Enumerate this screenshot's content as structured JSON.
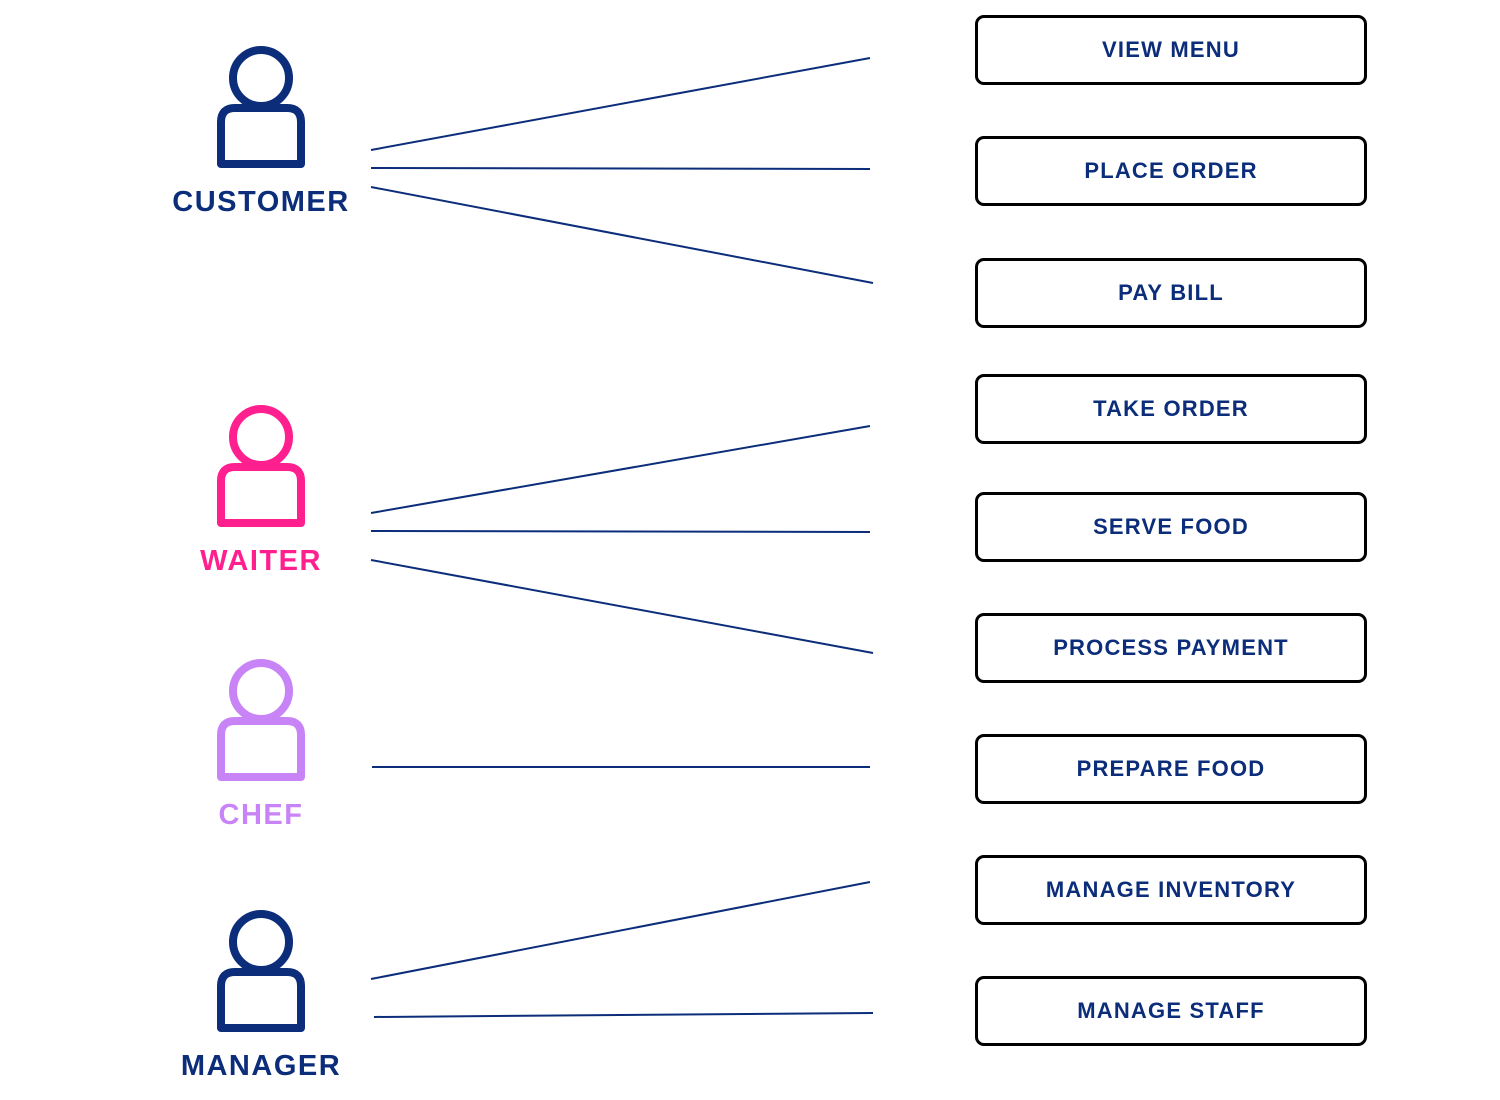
{
  "colors": {
    "line": "#0b2d7a",
    "usecase_text": "#0b2d7a",
    "usecase_border": "#000000"
  },
  "actors": [
    {
      "label": "CUSTOMER",
      "color": "#0b2d7a"
    },
    {
      "label": "WAITER",
      "color": "#ff1f8e"
    },
    {
      "label": "CHEF",
      "color": "#c884f7"
    },
    {
      "label": "MANAGER",
      "color": "#0b2d7a"
    }
  ],
  "use_cases": [
    {
      "label": "VIEW MENU"
    },
    {
      "label": "PLACE ORDER"
    },
    {
      "label": "PAY BILL"
    },
    {
      "label": "TAKE ORDER"
    },
    {
      "label": "SERVE FOOD"
    },
    {
      "label": "PROCESS PAYMENT"
    },
    {
      "label": "PREPARE FOOD"
    },
    {
      "label": "MANAGE INVENTORY"
    },
    {
      "label": "MANAGE STAFF"
    }
  ],
  "associations": [
    {
      "actor": "CUSTOMER",
      "use_case": "VIEW MENU"
    },
    {
      "actor": "CUSTOMER",
      "use_case": "PLACE ORDER"
    },
    {
      "actor": "CUSTOMER",
      "use_case": "PAY BILL"
    },
    {
      "actor": "WAITER",
      "use_case": "TAKE ORDER"
    },
    {
      "actor": "WAITER",
      "use_case": "SERVE FOOD"
    },
    {
      "actor": "WAITER",
      "use_case": "PROCESS PAYMENT"
    },
    {
      "actor": "CHEF",
      "use_case": "PREPARE FOOD"
    },
    {
      "actor": "MANAGER",
      "use_case": "MANAGE INVENTORY"
    },
    {
      "actor": "MANAGER",
      "use_case": "MANAGE STAFF"
    }
  ]
}
